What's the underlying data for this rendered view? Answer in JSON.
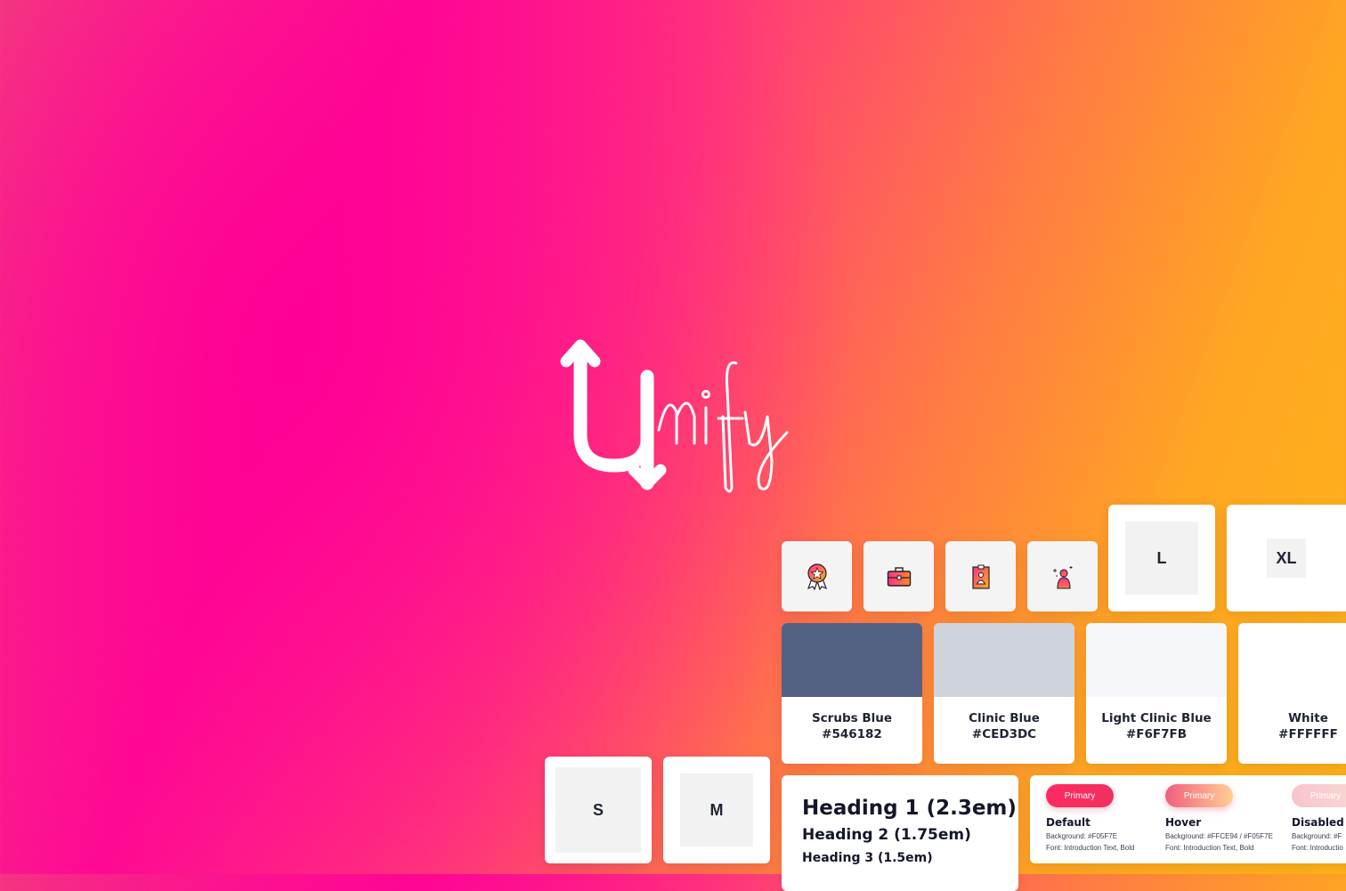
{
  "brand": {
    "name": "Unify",
    "gradient_colors": [
      "#FF0A93",
      "#FF7A45",
      "#FFB418"
    ]
  },
  "icons": [
    {
      "name": "award-badge-icon"
    },
    {
      "name": "briefcase-icon"
    },
    {
      "name": "id-badge-icon"
    },
    {
      "name": "user-sparkle-icon"
    }
  ],
  "sizes": {
    "s": "S",
    "m": "M",
    "l": "L",
    "xl": "XL"
  },
  "swatches": [
    {
      "name": "Scrubs Blue",
      "hex": "#546182",
      "color": "#546182"
    },
    {
      "name": "Clinic Blue",
      "hex": "#CED3DC",
      "color": "#CED3DC"
    },
    {
      "name": "Light Clinic Blue",
      "hex": "#F6F7FB",
      "color": "#F6F7FB"
    },
    {
      "name": "White",
      "hex": "#FFFFFF",
      "color": "#FFFFFF"
    }
  ],
  "typography": {
    "h1": "Heading 1 (2.3em)",
    "h2": "Heading 2 (1.75em)",
    "h3": "Heading 3 (1.5em)"
  },
  "buttons": [
    {
      "label": "Primary",
      "state": "Default",
      "background": "Background: #F05F7E",
      "font": "Font: Introduction Text, Bold"
    },
    {
      "label": "Primary",
      "state": "Hover",
      "background": "Background: #FFCE94 / #F05F7E",
      "font": "Font: Introduction Text, Bold"
    },
    {
      "label": "Primary",
      "state": "Disabled",
      "background": "Background: #F",
      "font": "Font: Introductio"
    }
  ]
}
